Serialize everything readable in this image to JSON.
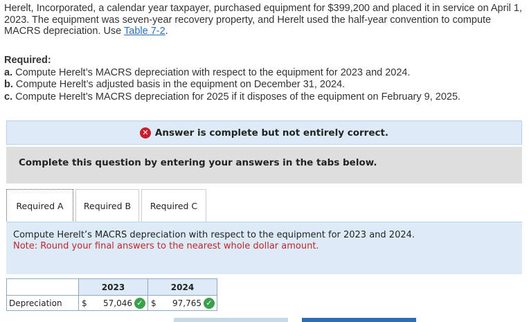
{
  "problem": {
    "text": "Herelt, Incorporated, a calendar year taxpayer, purchased equipment for $399,200 and placed it in service on April 1, 2023. The equipment was seven-year recovery property, and Herelt used the half-year convention to compute MACRS depreciation. Use ",
    "link": "Table 7-2",
    "text_end": "."
  },
  "required": {
    "title": "Required:",
    "items": [
      {
        "letter": "a.",
        "text": " Compute Herelt’s MACRS depreciation with respect to the equipment for 2023 and 2024."
      },
      {
        "letter": "b.",
        "text": " Compute Herelt’s adjusted basis in the equipment on December 31, 2024."
      },
      {
        "letter": "c.",
        "text": " Compute Herelt’s MACRS depreciation for 2025 if it disposes of the equipment on February 9, 2025."
      }
    ]
  },
  "banner": {
    "icon": "x-circle-icon",
    "text": "Answer is complete but not entirely correct.",
    "color": "#c81e2b"
  },
  "instructions": "Complete this question by entering your answers in the tabs below.",
  "tabs": [
    {
      "label": "Required A",
      "active": true
    },
    {
      "label": "Required B",
      "active": false
    },
    {
      "label": "Required C",
      "active": false
    }
  ],
  "panel": {
    "prompt": "Compute Herelt’s MACRS depreciation with respect to the equipment for 2023 and 2024.",
    "note": "Note: Round your final answers to the nearest whole dollar amount."
  },
  "table": {
    "headers": [
      "2023",
      "2024"
    ],
    "row_label": "Depreciation",
    "cells": [
      {
        "currency": "$",
        "value": "57,046",
        "status": "correct"
      },
      {
        "currency": "$",
        "value": "97,765",
        "status": "correct"
      }
    ]
  },
  "colors": {
    "correct": "#3aa04c",
    "incorrect": "#c81e2b",
    "accent": "#2d6db5",
    "panel_bg": "#dcebf7"
  }
}
